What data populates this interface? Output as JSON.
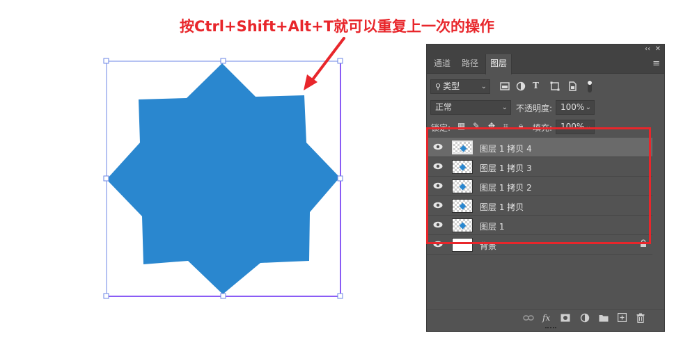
{
  "annotation": {
    "caption": "按Ctrl+Shift+Alt+T就可以重复上一次的操作",
    "color": "#e8262b"
  },
  "canvas": {
    "shape_color": "#2a87cf",
    "bbox_color": "#8a5cf5"
  },
  "panel": {
    "tabs": [
      {
        "label": "通道",
        "active": false
      },
      {
        "label": "路径",
        "active": false
      },
      {
        "label": "图层",
        "active": true
      }
    ],
    "collapse_glyph": "‹‹",
    "close_glyph": "✕",
    "menu_glyph": "≡",
    "filter": {
      "label": "类型",
      "search_glyph": "⚲"
    },
    "blend_mode": "正常",
    "opacity": {
      "label": "不透明度:",
      "value": "100%"
    },
    "lock": {
      "label": "锁定:"
    },
    "fill": {
      "label": "填充:",
      "value": "100%"
    },
    "layers": [
      {
        "name": "图层 1 拷贝 4",
        "selected": true,
        "thumb": "transparent"
      },
      {
        "name": "图层 1 拷贝 3",
        "selected": false,
        "thumb": "transparent"
      },
      {
        "name": "图层 1 拷贝 2",
        "selected": false,
        "thumb": "transparent"
      },
      {
        "name": "图层 1 拷贝",
        "selected": false,
        "thumb": "transparent"
      },
      {
        "name": "图层 1",
        "selected": false,
        "thumb": "transparent"
      },
      {
        "name": "背景",
        "selected": false,
        "thumb": "white",
        "locked": true
      }
    ],
    "bottom": {
      "fx": "fx"
    }
  }
}
